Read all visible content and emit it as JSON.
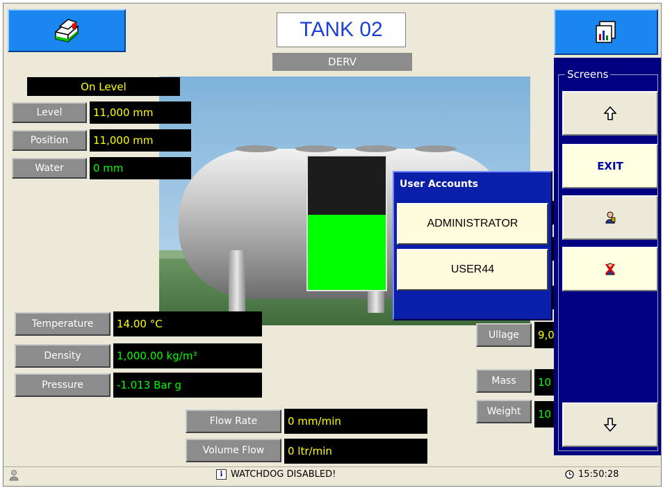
{
  "header": {
    "title": "TANK 02",
    "product": "DERV"
  },
  "status_banner": "On Level",
  "left_readings": [
    {
      "label": "Level",
      "value": "11,000 mm"
    },
    {
      "label": "Position",
      "value": "11,000 mm"
    },
    {
      "label": "Water",
      "value": "0 mm"
    }
  ],
  "tank": {
    "level_fraction": 0.56,
    "fill_color": "#00ff00"
  },
  "env_readings": [
    {
      "label": "Temperature",
      "value": "14.00 °C"
    },
    {
      "label": "Density",
      "value": "1,000.00 kg/m³"
    },
    {
      "label": "Pressure",
      "value": "-1.013 Bar g"
    }
  ],
  "flow_readings": [
    {
      "label": "Flow Rate",
      "value": "0 mm/min"
    },
    {
      "label": "Volume Flow",
      "value": "0 ltr/min"
    }
  ],
  "right_readings": [
    {
      "label": "Ullage",
      "value": "9,0"
    },
    {
      "label": "Mass",
      "value": "10"
    },
    {
      "label": "Weight",
      "value": "10"
    }
  ],
  "user_accounts": {
    "title": "User Accounts",
    "accounts": [
      "ADMINISTRATOR",
      "USER44"
    ]
  },
  "screens_panel": {
    "title": "Screens",
    "exit_label": "EXIT"
  },
  "status_bar": {
    "message": "WATCHDOG DISABLED!",
    "time": "15:50:28"
  },
  "colors": {
    "accent_blue": "#1a86f0",
    "panel_navy": "#000080",
    "value_yellow": "#ffff00",
    "value_green": "#00ff00"
  },
  "icons": [
    "tanks-icon",
    "reports-icon",
    "arrow-up-icon",
    "user-login-icon",
    "user-logout-icon",
    "arrow-down-icon",
    "info-icon",
    "clock-icon"
  ]
}
